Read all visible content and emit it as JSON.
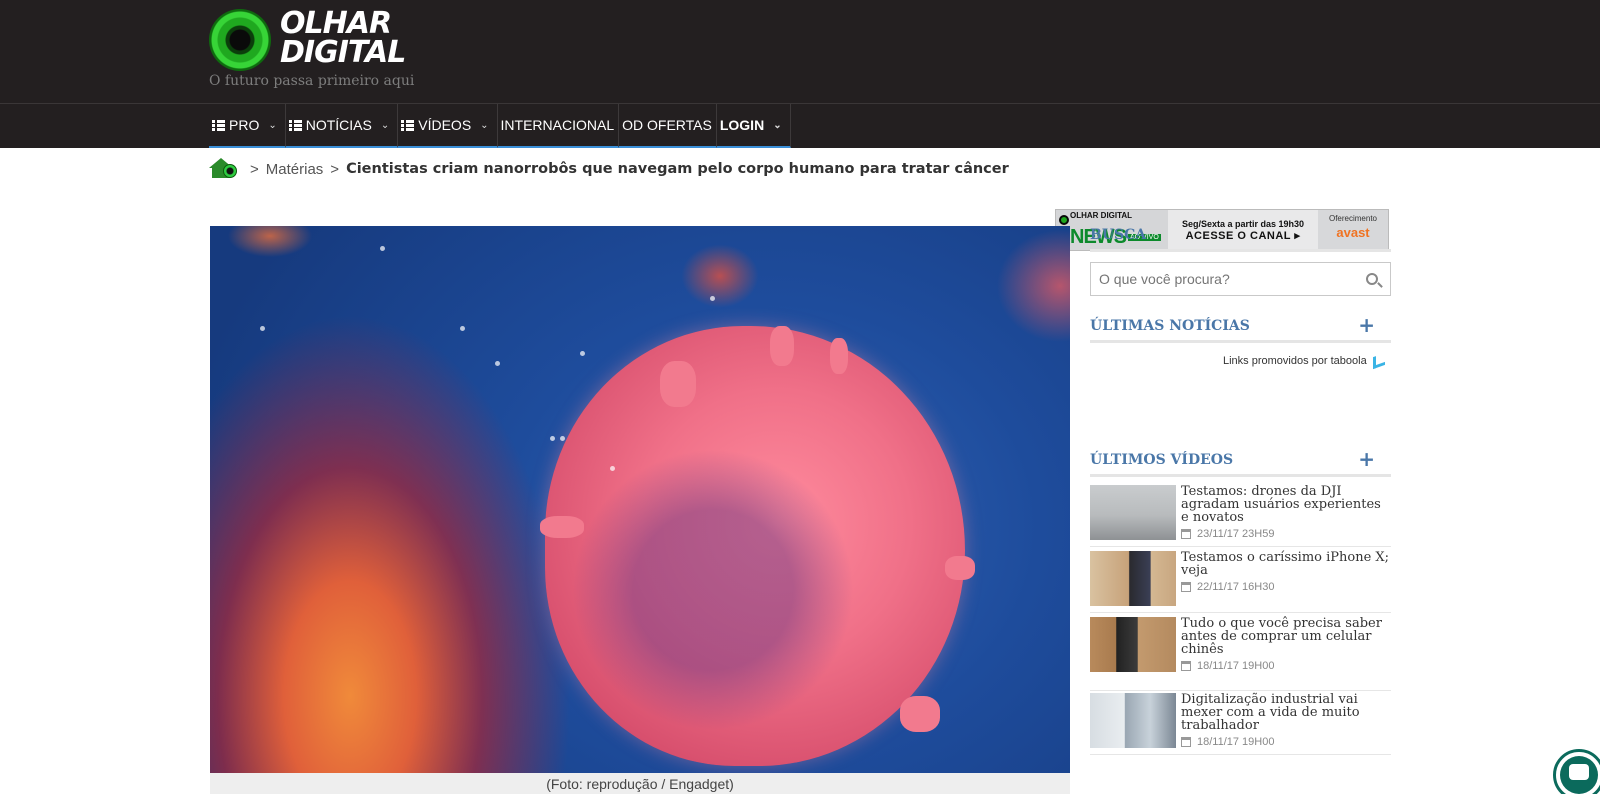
{
  "brand": {
    "logo_line1": "OLHAR",
    "logo_line2": "DIGITAL",
    "tagline": "O futuro passa primeiro aqui"
  },
  "nav": {
    "items": [
      {
        "label": "PRO",
        "grid": true,
        "dropdown": true
      },
      {
        "label": "NOTÍCIAS",
        "grid": true,
        "dropdown": true
      },
      {
        "label": "VÍDEOS",
        "grid": true,
        "dropdown": true
      },
      {
        "label": "INTERNACIONAL",
        "grid": false,
        "dropdown": false
      },
      {
        "label": "OD OFERTAS",
        "grid": false,
        "dropdown": false
      },
      {
        "label": "LOGIN",
        "grid": false,
        "dropdown": true
      }
    ]
  },
  "ad": {
    "brand_small": "OLHAR DIGITAL",
    "news": "NEWS",
    "live": "AO VIVO",
    "schedule": "Seg/Sexta a partir das 19h30",
    "cta": "ACESSE O CANAL ▸",
    "sponsor_label": "Oferecimento",
    "sponsor": "avast"
  },
  "breadcrumb": {
    "separator": ">",
    "section": "Matérias",
    "title": "Cientistas criam nanorrobôs que navegam pelo corpo humano para tratar câncer"
  },
  "article": {
    "caption": "(Foto: reprodução / Engadget)"
  },
  "sidebar": {
    "search_heading": "BUSCA",
    "search_placeholder": "O que você procura?",
    "news_heading": "ÚLTIMAS NOTÍCIAS",
    "plus": "+",
    "promo": "Links promovidos por taboola",
    "videos_heading": "ÚLTIMOS VÍDEOS",
    "videos": [
      {
        "title": "Testamos: drones da DJI agradam usuários experientes e novatos",
        "date": "23/11/17 23H59"
      },
      {
        "title": "Testamos o caríssimo iPhone X; veja",
        "date": "22/11/17 16H30"
      },
      {
        "title": "Tudo o que você precisa saber antes de comprar um celular chinês",
        "date": "18/11/17 19H00"
      },
      {
        "title": "Digitalização industrial vai mexer com a vida de muito trabalhador",
        "date": "18/11/17 19H00"
      }
    ]
  }
}
